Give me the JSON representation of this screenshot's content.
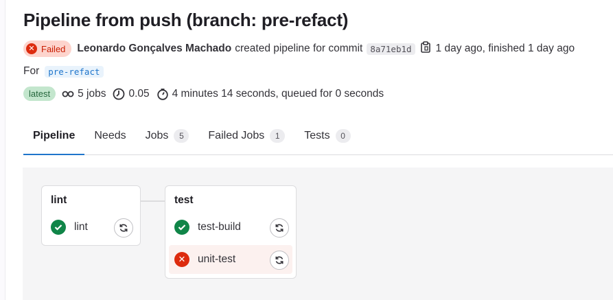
{
  "header": {
    "title": "Pipeline from push (branch: pre-refact)",
    "status_label": "Failed",
    "author": "Leonardo Gonçalves Machado",
    "created_text": "created pipeline for commit",
    "commit_sha": "8a71eb1d",
    "time_text": "1 day ago, finished 1 day ago",
    "for_label": "For",
    "branch": "pre-refact"
  },
  "stats": {
    "latest_badge": "latest",
    "jobs": "5 jobs",
    "duration_value": "0.05",
    "time": "4 minutes 14 seconds, queued for 0 seconds"
  },
  "tabs": [
    {
      "label": "Pipeline"
    },
    {
      "label": "Needs"
    },
    {
      "label": "Jobs",
      "count": "5"
    },
    {
      "label": "Failed Jobs",
      "count": "1"
    },
    {
      "label": "Tests",
      "count": "0"
    }
  ],
  "stages": [
    {
      "name": "lint",
      "jobs": [
        {
          "name": "lint",
          "status": "success"
        }
      ]
    },
    {
      "name": "test",
      "jobs": [
        {
          "name": "test-build",
          "status": "success"
        },
        {
          "name": "unit-test",
          "status": "failed"
        }
      ]
    }
  ],
  "colors": {
    "success": "#108548",
    "failed": "#dd2b0e",
    "accent": "#1f75cb"
  }
}
